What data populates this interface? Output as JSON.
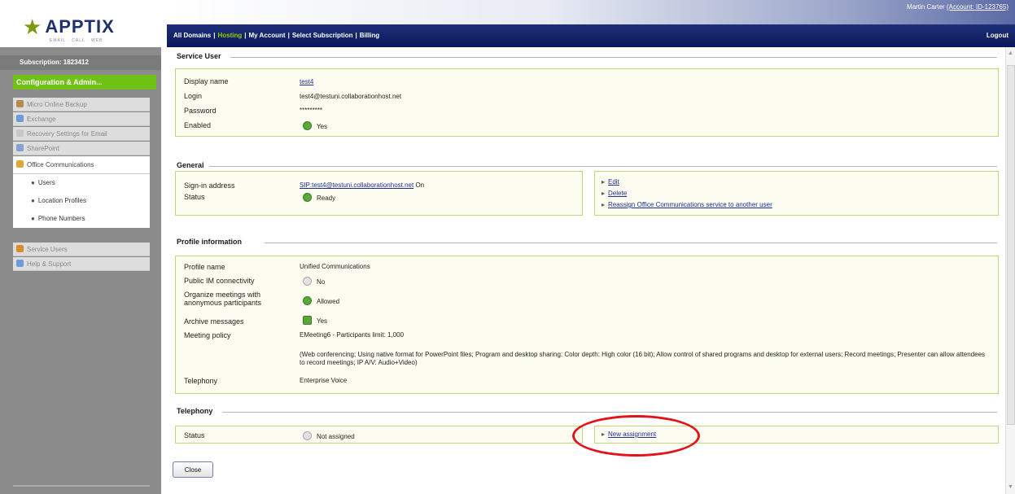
{
  "brand": {
    "name": "APPTIX",
    "tagline": "EMAIL · CALL · WEB"
  },
  "header": {
    "user_text": "Martin Carter",
    "account_text": "(Account: ID-123765)",
    "nav": [
      "All Domains",
      "Hosting",
      "My Account",
      "Select Subscription",
      "Billing"
    ],
    "nav_active": "Hosting",
    "logout": "Logout"
  },
  "sidebar": {
    "subscription": "Subscription: 1823412",
    "config": "Configuration & Admin...",
    "items": [
      {
        "label": "Micro Online Backup",
        "icon": "backup-icon"
      },
      {
        "label": "Exchange",
        "icon": "exchange-icon"
      },
      {
        "label": "Recovery Settings for Email",
        "icon": "recovery-icon"
      },
      {
        "label": "SharePoint",
        "icon": "sharepoint-icon"
      },
      {
        "label": "Office Communications",
        "icon": "office-comm-icon"
      }
    ],
    "subitems": [
      "Users",
      "Location Profiles",
      "Phone Numbers"
    ],
    "bottom_items": [
      {
        "label": "Service Users",
        "icon": "service-users-icon"
      },
      {
        "label": "Help & Support",
        "icon": "help-icon"
      }
    ]
  },
  "service_user": {
    "title": "Service User",
    "display_name_label": "Display name",
    "display_name": "test4",
    "login_label": "Login",
    "login": "test4@testuni.collaborationhost.net",
    "password_label": "Password",
    "password": "*********",
    "enabled_label": "Enabled",
    "enabled": "Yes"
  },
  "general": {
    "title": "General",
    "sign_in_label": "Sign-in address",
    "sign_in": "SIP:test4@testuni.collaborationhost.net",
    "sign_in_suffix": "On",
    "status_label": "Status",
    "status": "Ready",
    "actions": [
      "Edit",
      "Delete",
      "Reassign Office Communications service to another user"
    ]
  },
  "profile": {
    "title": "Profile information",
    "rows": [
      {
        "label": "Profile name",
        "value": "Unified Communications"
      },
      {
        "label": "Public IM connectivity",
        "value": "No"
      },
      {
        "label": "Organize meetings with anonymous participants",
        "value": "Allowed"
      },
      {
        "label": "Archive messages",
        "value": "Yes"
      },
      {
        "label": "Meeting policy",
        "value": "EMeeting6 - Participants limit: 1,000"
      },
      {
        "label": "Telephony",
        "value": "Enterprise Voice"
      }
    ],
    "meeting_details": "(Web conferencing; Using native format for PowerPoint files; Program and desktop sharing: Color depth: High color (16 bit); Allow control of shared programs and desktop for external users; Record meetings; Presenter can allow attendees to record meetings; IP A/V: Audio+Video)"
  },
  "telephony": {
    "title": "Telephony",
    "status_label": "Status",
    "status": "Not assigned",
    "action": "New assignment"
  },
  "buttons": {
    "close": "Close"
  },
  "colors": {
    "nav_bg": "#0b185a",
    "accent_green": "#6fc215",
    "sidebar_bg": "#8b8b8b",
    "box_border": "#c5d37a",
    "highlight": "#e3131b"
  }
}
